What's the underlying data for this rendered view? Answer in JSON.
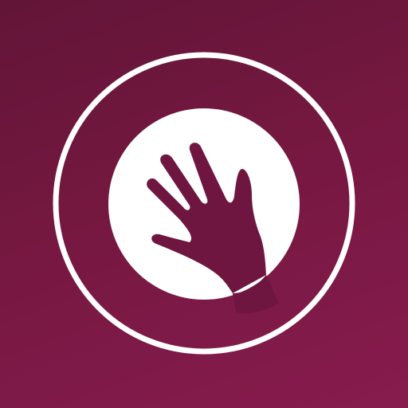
{
  "icon": {
    "semantic": "raised-hand-icon",
    "colors": {
      "background_top": "#621538",
      "background_mid": "#751840",
      "background_bottom": "#871b4e",
      "foreground": "#ffffff",
      "hand": "#6e1640"
    }
  }
}
